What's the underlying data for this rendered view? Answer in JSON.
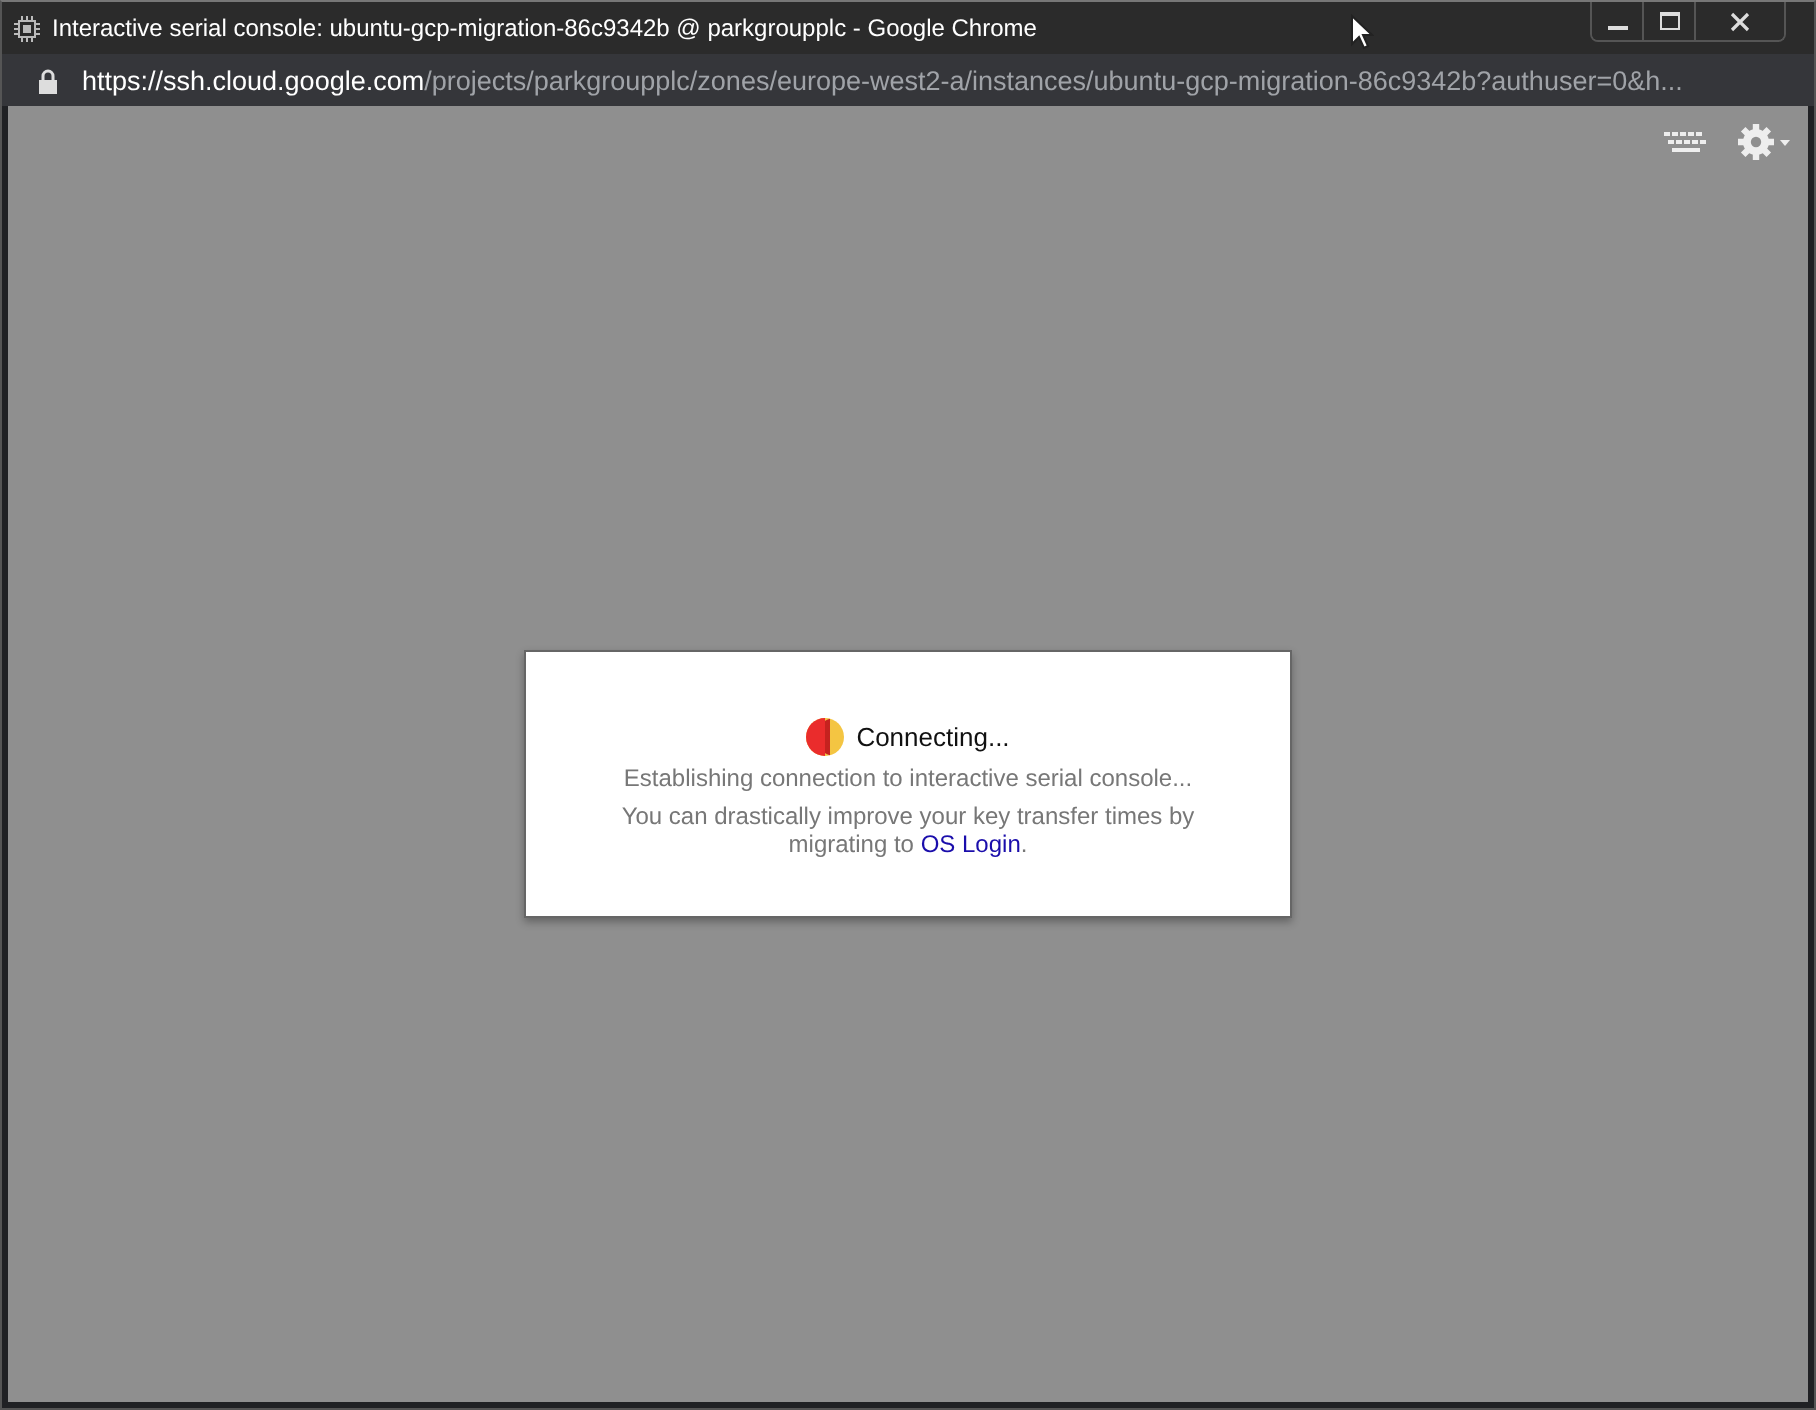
{
  "window": {
    "title": "Interactive serial console: ubuntu-gcp-migration-86c9342b @ parkgroupplc - Google Chrome"
  },
  "address_bar": {
    "host": "https://ssh.cloud.google.com",
    "path": "/projects/parkgroupplc/zones/europe-west2-a/instances/ubuntu-gcp-migration-86c9342b?authuser=0&h..."
  },
  "dialog": {
    "heading": "Connecting...",
    "status": "Establishing connection to interactive serial console...",
    "note": "You can drastically improve your key transfer times by migrating to",
    "link": "OS Login",
    "note_end": "."
  }
}
